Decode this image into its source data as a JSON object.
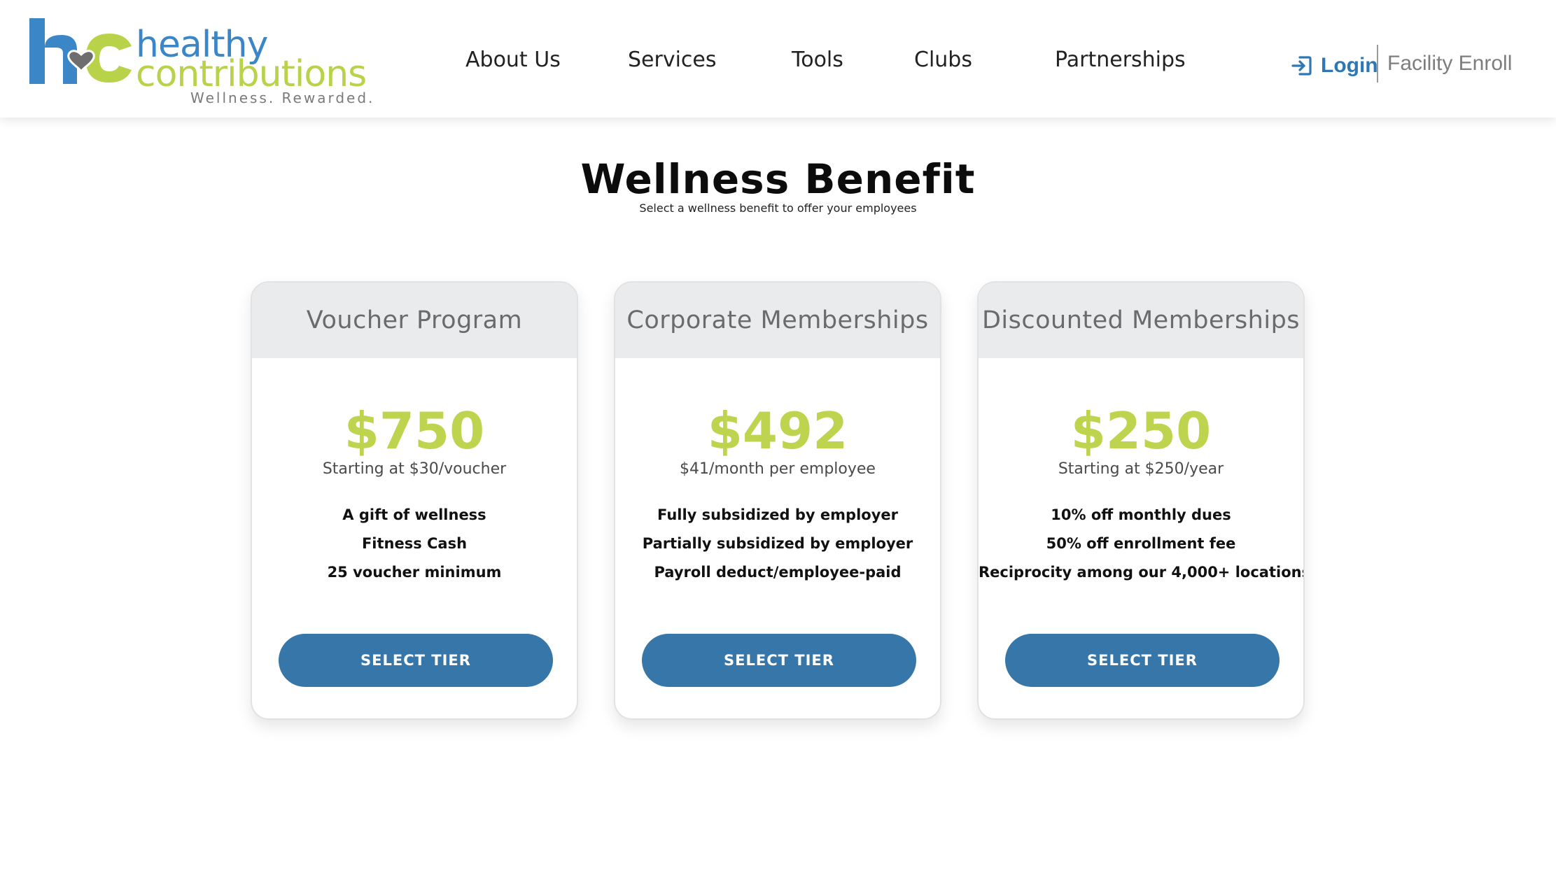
{
  "brand": {
    "name_line1": "healthy",
    "name_line2": "contributions",
    "tagline": "Wellness. Rewarded.",
    "colors": {
      "blue": "#3a86c6",
      "green": "#b8d24a",
      "heart": "#6e6e6e"
    }
  },
  "nav": {
    "items": [
      {
        "label": "About Us"
      },
      {
        "label": "Services"
      },
      {
        "label": "Tools"
      },
      {
        "label": "Clubs"
      },
      {
        "label": "Partnerships"
      }
    ],
    "login_icon": "login-arrow-icon",
    "login_label": "Login",
    "facility_label": "Facility Enroll"
  },
  "hero": {
    "title": "Wellness Benefit",
    "subtitle": "Select a wellness benefit to offer your employees"
  },
  "colors": {
    "price_green": "#bfd44e",
    "button_blue": "#3676a8",
    "card_header_gray": "#eaebec"
  },
  "cards": [
    {
      "title": "Voucher Program",
      "price": "$750",
      "price_note": "Starting at $30/voucher",
      "features": [
        "A gift of wellness",
        "Fitness Cash",
        "25 voucher minimum"
      ],
      "button": "SELECT TIER"
    },
    {
      "title": "Corporate Memberships",
      "price": "$492",
      "price_note": "$41/month per employee",
      "features": [
        "Fully subsidized by employer",
        "Partially subsidized by employer",
        "Payroll deduct/employee-paid"
      ],
      "button": "SELECT TIER"
    },
    {
      "title": "Discounted Memberships",
      "price": "$250",
      "price_note": "Starting at $250/year",
      "features": [
        "10% off monthly dues",
        "50% off enrollment fee",
        "Reciprocity among our 4,000+ locations"
      ],
      "button": "SELECT TIER"
    }
  ]
}
